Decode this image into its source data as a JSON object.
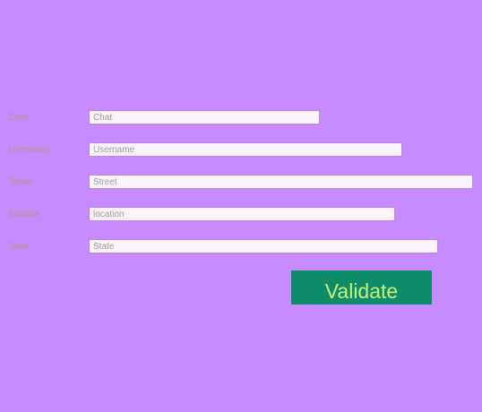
{
  "form": {
    "fields": [
      {
        "label": "Chat",
        "value": "",
        "placeholder": "Chat"
      },
      {
        "label": "Username",
        "value": "",
        "placeholder": "Username"
      },
      {
        "label": "Street",
        "value": "",
        "placeholder": "Street"
      },
      {
        "label": "location",
        "value": "",
        "placeholder": "location"
      },
      {
        "label": "State",
        "value": "",
        "placeholder": "State"
      }
    ],
    "submit_label": "Validate"
  },
  "colors": {
    "background": "#c78bff",
    "button_background": "#0e8b68",
    "button_text": "#c8f27a",
    "label_text": "#b19a7a",
    "input_background": "#fbf3fb"
  }
}
